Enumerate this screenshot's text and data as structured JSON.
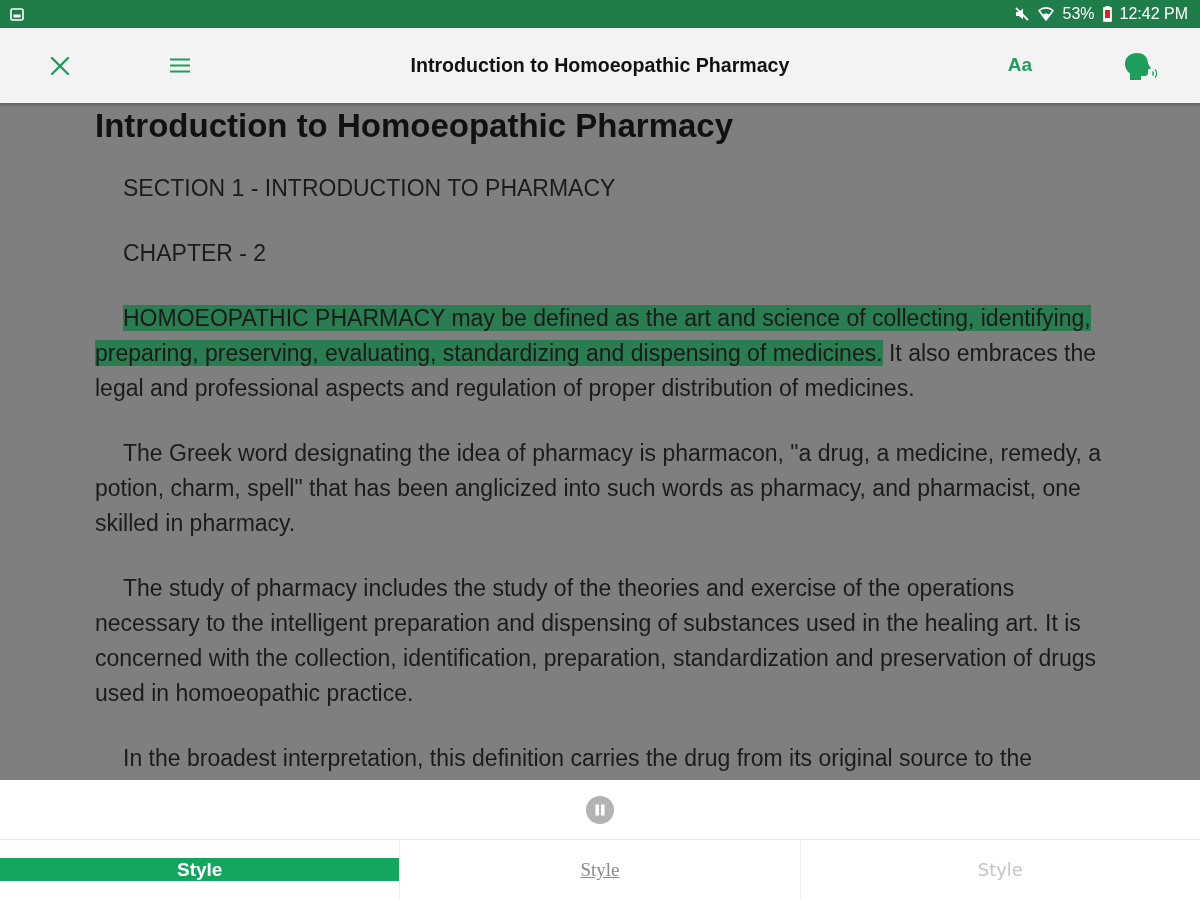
{
  "status_bar": {
    "battery": "53%",
    "time": "12:42 PM"
  },
  "app_bar": {
    "title": "Introduction to Homoeopathic Pharmacy",
    "font_button": "Aa"
  },
  "document": {
    "heading": "Introduction to Homoeopathic Pharmacy",
    "paragraphs": [
      {
        "segments": [
          {
            "text": "SECTION 1 - INTRODUCTION TO PHARMACY",
            "highlighted": false
          }
        ]
      },
      {
        "segments": [
          {
            "text": "CHAPTER - 2",
            "highlighted": false
          }
        ]
      },
      {
        "segments": [
          {
            "text": "HOMOEOPATHIC PHARMACY may be defined as the art and science of collecting, identifying, preparing, preserving, evaluating, standardizing and dispensing of medicines.",
            "highlighted": true
          },
          {
            "text": " It also embraces the legal and professional aspects and regulation of proper distribution of medicines.",
            "highlighted": false
          }
        ]
      },
      {
        "segments": [
          {
            "text": "The Greek word designating the idea of pharmacy is pharmacon, \"a drug, a medicine, remedy, a potion, charm, spell\" that has been anglicized into such words as pharmacy, and pharmacist, one skilled in pharmacy.",
            "highlighted": false
          }
        ]
      },
      {
        "segments": [
          {
            "text": "The study of pharmacy includes the study of the theories and exercise of the operations necessary to the intelligent preparation and dispensing of substances used in the healing art. It is concerned with the collection, identification, preparation, standardization and preservation of drugs used in homoeopathic practice.",
            "highlighted": false
          }
        ]
      },
      {
        "segments": [
          {
            "text": "In the broadest interpretation, this definition carries the drug from its original source to the",
            "highlighted": false
          }
        ]
      }
    ]
  },
  "player": {
    "playing": true
  },
  "style_tabs": [
    {
      "label": "Style",
      "kind": "sans",
      "selected": true
    },
    {
      "label": "Style",
      "kind": "serif",
      "selected": false
    },
    {
      "label": "Style",
      "kind": "light",
      "selected": false
    }
  ]
}
